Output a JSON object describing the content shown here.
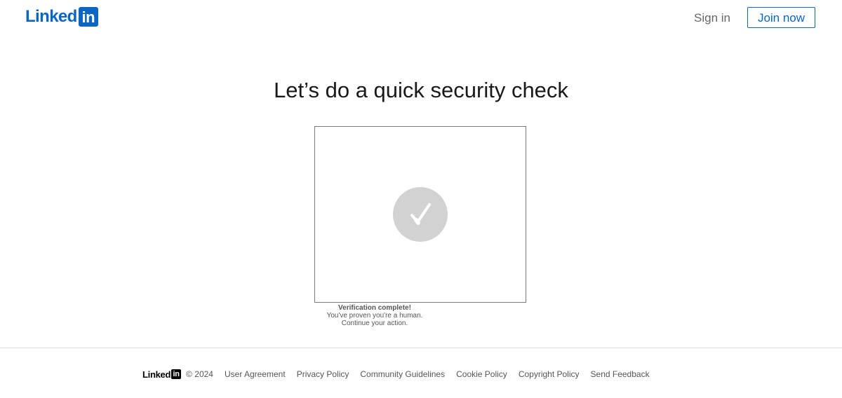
{
  "colors": {
    "brand_blue": "#0a66c2",
    "check_circle": "#d2d2d2",
    "footer_text": "#555555"
  },
  "header": {
    "logo": {
      "word": "Linked",
      "box": "in"
    },
    "sign_in_label": "Sign in",
    "join_now_label": "Join now"
  },
  "main": {
    "title": "Let’s do a quick security check",
    "challenge": {
      "icon": "checkmark-icon",
      "status_title": "Verification complete!",
      "status_line_1": "You've proven you're a human.",
      "status_line_2": "Continue your action."
    }
  },
  "footer": {
    "logo": {
      "word": "Linked",
      "box": "in"
    },
    "copyright": "© 2024",
    "links": [
      "User Agreement",
      "Privacy Policy",
      "Community Guidelines",
      "Cookie Policy",
      "Copyright Policy",
      "Send Feedback"
    ]
  }
}
